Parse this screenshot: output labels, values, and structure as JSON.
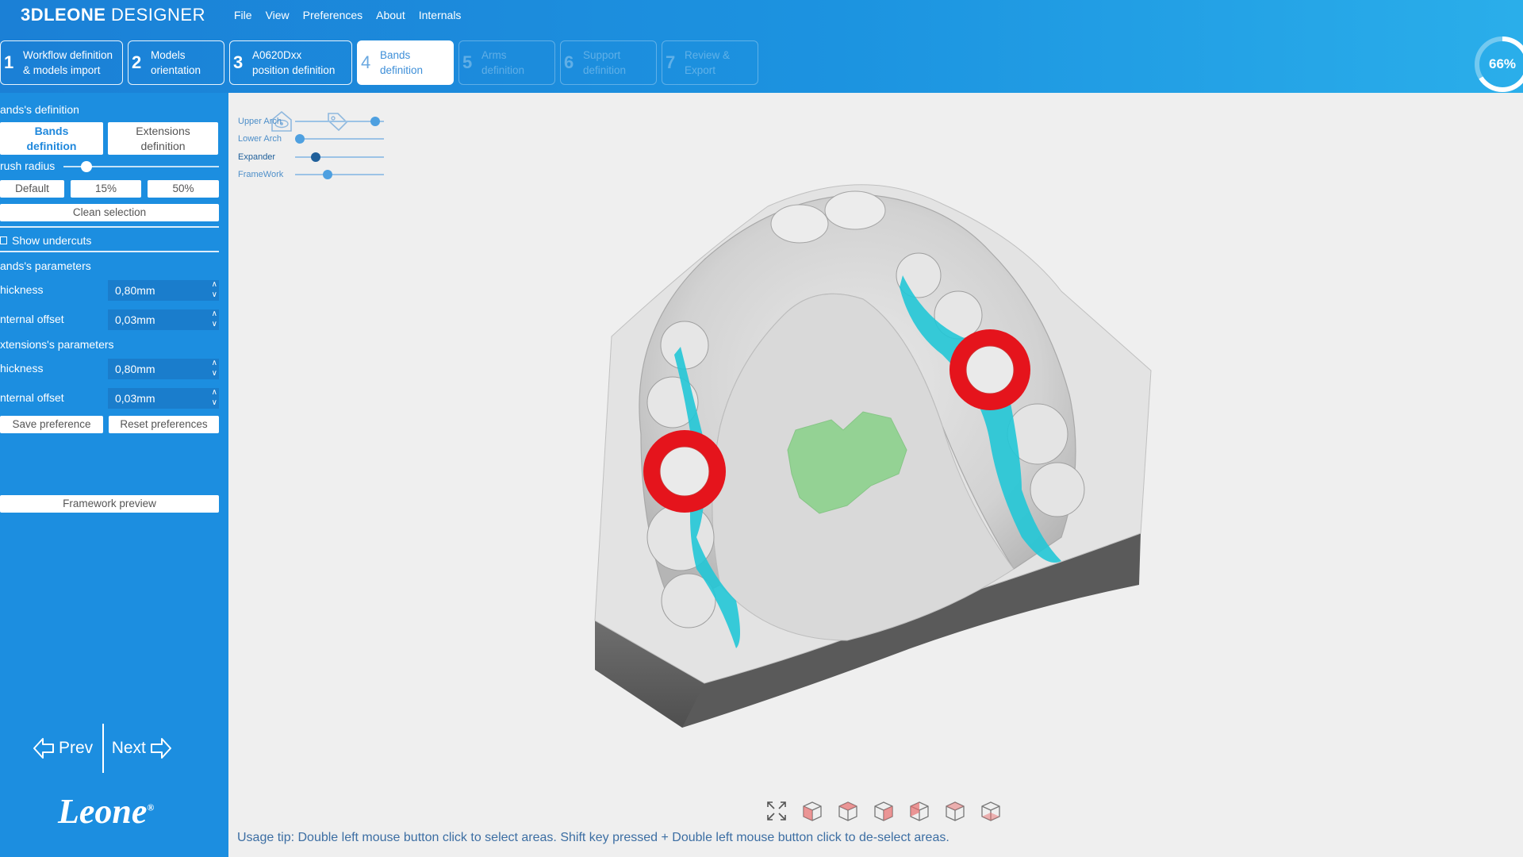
{
  "app": {
    "brand_bold": "3DLEONE",
    "brand_light": "DESIGNER"
  },
  "menu": [
    "File",
    "View",
    "Preferences",
    "About",
    "Internals"
  ],
  "steps": [
    {
      "num": "1",
      "label": "Workflow definition\n& models import",
      "state": "done"
    },
    {
      "num": "2",
      "label": "Models\norientation",
      "state": "done"
    },
    {
      "num": "3",
      "label": "A0620Dxx\nposition definition",
      "state": "done"
    },
    {
      "num": "4",
      "label": "Bands\ndefinition",
      "state": "active"
    },
    {
      "num": "5",
      "label": "Arms\ndefinition",
      "state": "disabled"
    },
    {
      "num": "6",
      "label": "Support\ndefinition",
      "state": "disabled"
    },
    {
      "num": "7",
      "label": "Review &\nExport",
      "state": "disabled"
    }
  ],
  "progress": {
    "value": 0.66,
    "label": "66%"
  },
  "sidebar": {
    "section_title": "ands's definition",
    "tab_bands": "Bands\ndefinition",
    "tab_extensions": "Extensions\ndefinition",
    "brush_label": "rush radius",
    "brush_level": 0.15,
    "brush_default": "Default",
    "brush_15": "15%",
    "brush_50": "50%",
    "clean_selection": "Clean selection",
    "show_undercuts": "Show undercuts",
    "bands_params_title": "ands's parameters",
    "ext_params_title": "xtensions's parameters",
    "bands_thickness_label": "hickness",
    "bands_thickness_value": "0,80mm",
    "bands_offset_label": "nternal offset",
    "bands_offset_value": "0,03mm",
    "ext_thickness_label": "hickness",
    "ext_thickness_value": "0,80mm",
    "ext_offset_label": "nternal offset",
    "ext_offset_value": "0,03mm",
    "save_pref": "Save preference",
    "reset_pref": "Reset preferences",
    "framework_preview": "Framework preview",
    "prev": "Prev",
    "next": "Next",
    "logo": "Leone"
  },
  "layers": [
    {
      "name": "Upper Arch",
      "level": 0.95,
      "active": false
    },
    {
      "name": "Lower Arch",
      "level": 0.0,
      "active": false
    },
    {
      "name": "Expander",
      "level": 0.2,
      "active": true
    },
    {
      "name": "FrameWork",
      "level": 0.35,
      "active": false
    }
  ],
  "view_buttons": [
    "fit-view-icon",
    "front-view-icon",
    "back-view-icon",
    "left-view-icon",
    "right-view-icon",
    "top-view-icon",
    "bottom-view-icon"
  ],
  "usage_tip": "Usage tip: Double left mouse button click to select areas. Shift key pressed + Double left mouse button click to de-select areas.",
  "colors": {
    "accent": "#1c8ee0",
    "band": "#e5141c",
    "extension": "#22c6d6",
    "expander": "#7ed07e"
  }
}
